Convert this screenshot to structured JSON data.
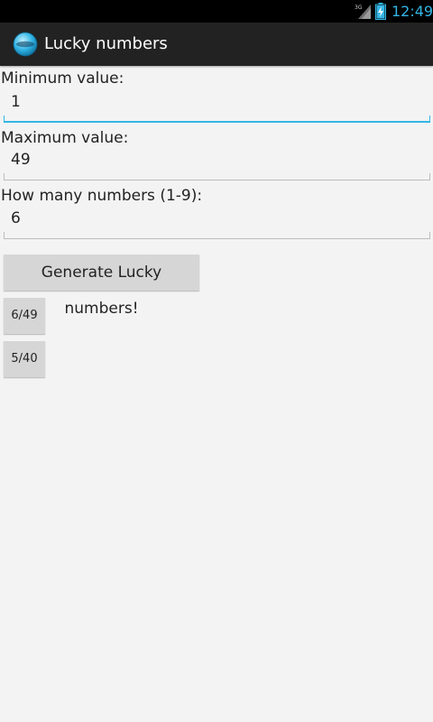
{
  "status_bar": {
    "network": "3G",
    "time": "12:49",
    "accent": "#33b5e5"
  },
  "action_bar": {
    "app_icon": "lucky-logo-icon",
    "title": "Lucky numbers"
  },
  "form": {
    "min": {
      "label": "Minimum value:",
      "value": "1",
      "focused": true
    },
    "max": {
      "label": "Maximum value:",
      "value": "49"
    },
    "count": {
      "label": "How many numbers (1-9):",
      "value": "6"
    }
  },
  "buttons": {
    "generate": "Generate Lucky numbers!",
    "preset_649": "6/49",
    "preset_540": "5/40"
  }
}
